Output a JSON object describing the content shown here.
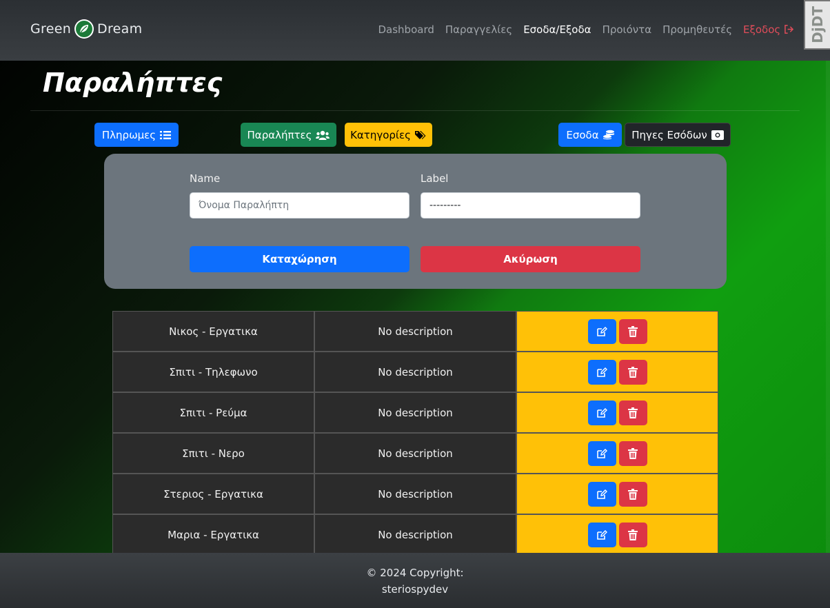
{
  "navbar": {
    "brand_left": "Green",
    "brand_right": "Dream",
    "links": [
      {
        "label": "Dashboard"
      },
      {
        "label": "Παραγγελίες"
      },
      {
        "label": "Εσοδα/Εξοδα"
      },
      {
        "label": "Προιόντα"
      },
      {
        "label": "Προμηθευτές"
      },
      {
        "label": "Εξοδος"
      }
    ],
    "djdt": "DjDT"
  },
  "page": {
    "title": "Παραλήπτες"
  },
  "toolbar": {
    "payments_label": "Πληρωμες",
    "recipients_label": "Παραλήπτες",
    "categories_label": "Κατηγορίες",
    "income_label": "Εσοδα",
    "income_sources_label": "Πηγες Εσόδων"
  },
  "form": {
    "name_label": "Name",
    "name_placeholder": "Όνομα Παραλήπτη",
    "label_label": "Label",
    "label_value": "---------",
    "submit_label": "Καταχώρηση",
    "cancel_label": "Ακύρωση"
  },
  "table": {
    "rows": [
      {
        "name": "Νικος - Εργατικα",
        "description": "No description"
      },
      {
        "name": "Σπιτι - Τηλεφωνο",
        "description": "No description"
      },
      {
        "name": "Σπιτι - Ρεύμα",
        "description": "No description"
      },
      {
        "name": "Σπιτι - Νερο",
        "description": "No description"
      },
      {
        "name": "Στεριος - Εργατικα",
        "description": "No description"
      },
      {
        "name": "Μαρια - Εργατικα",
        "description": "No description"
      }
    ]
  },
  "footer": {
    "copyright": "© 2024 Copyright:",
    "author": "steriospydev"
  },
  "colors": {
    "primary": "#0d6efd",
    "success": "#198754",
    "warning": "#ffc107",
    "danger": "#dc3545",
    "dark": "#212529"
  }
}
